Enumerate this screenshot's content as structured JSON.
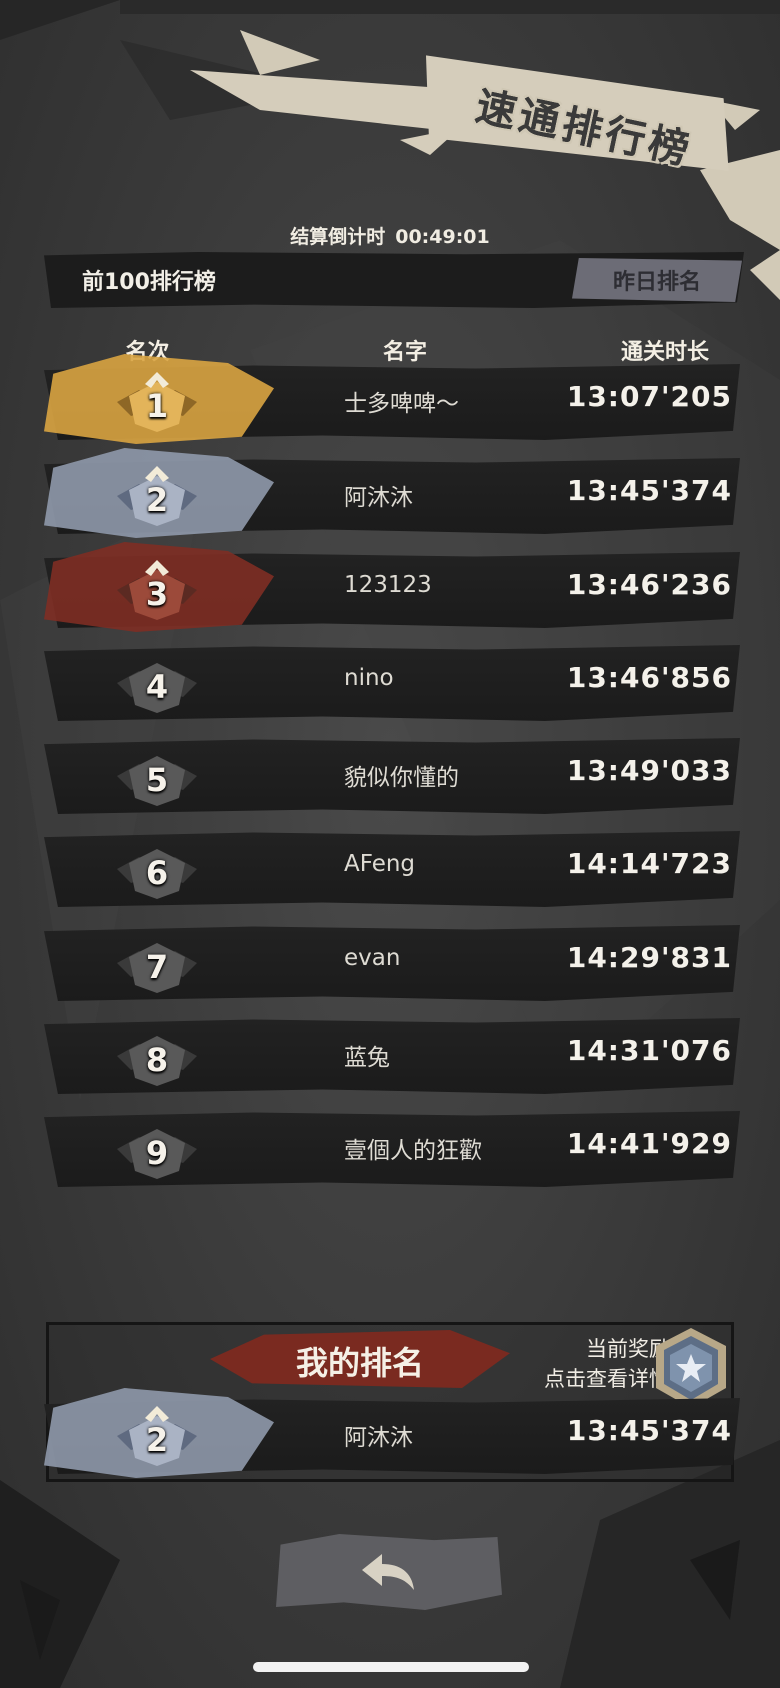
{
  "header": {
    "title": "速通排行榜",
    "countdown_label": "结算倒计时",
    "countdown_value": "00:49:01"
  },
  "board": {
    "top100_label": "前100排行榜",
    "yesterday_button": "昨日排名"
  },
  "columns": {
    "rank": "名次",
    "name": "名字",
    "time": "通关时长"
  },
  "rows": [
    {
      "rank": "1",
      "name": "士多啤啤～",
      "time": "13:07'205",
      "tier": "gold"
    },
    {
      "rank": "2",
      "name": "阿沐沐",
      "time": "13:45'374",
      "tier": "silver"
    },
    {
      "rank": "3",
      "name": "123123",
      "time": "13:46'236",
      "tier": "bronze"
    },
    {
      "rank": "4",
      "name": "nino",
      "time": "13:46'856",
      "tier": "normal"
    },
    {
      "rank": "5",
      "name": "貌似你懂的",
      "time": "13:49'033",
      "tier": "normal"
    },
    {
      "rank": "6",
      "name": "AFeng",
      "time": "14:14'723",
      "tier": "normal"
    },
    {
      "rank": "7",
      "name": "evan",
      "time": "14:29'831",
      "tier": "normal"
    },
    {
      "rank": "8",
      "name": "蓝兔",
      "time": "14:31'076",
      "tier": "normal"
    },
    {
      "rank": "9",
      "name": "壹個人的狂歡",
      "time": "14:41'929",
      "tier": "normal"
    }
  ],
  "my_rank": {
    "title": "我的排名",
    "reward_line1": "当前奖励",
    "reward_line2": "点击查看详情",
    "rank": "2",
    "name": "阿沐沐",
    "time": "13:45'374",
    "tier": "silver",
    "reward_medal_icon": "silver-star-medal-icon"
  },
  "footer": {
    "back_icon": "back-arrow-icon"
  },
  "colors": {
    "gold": "#d9a441",
    "silver": "#9aa3b5",
    "bronze": "#8a3328",
    "accent_red": "#8a2a22",
    "row_bg": "#1e1e1e"
  }
}
